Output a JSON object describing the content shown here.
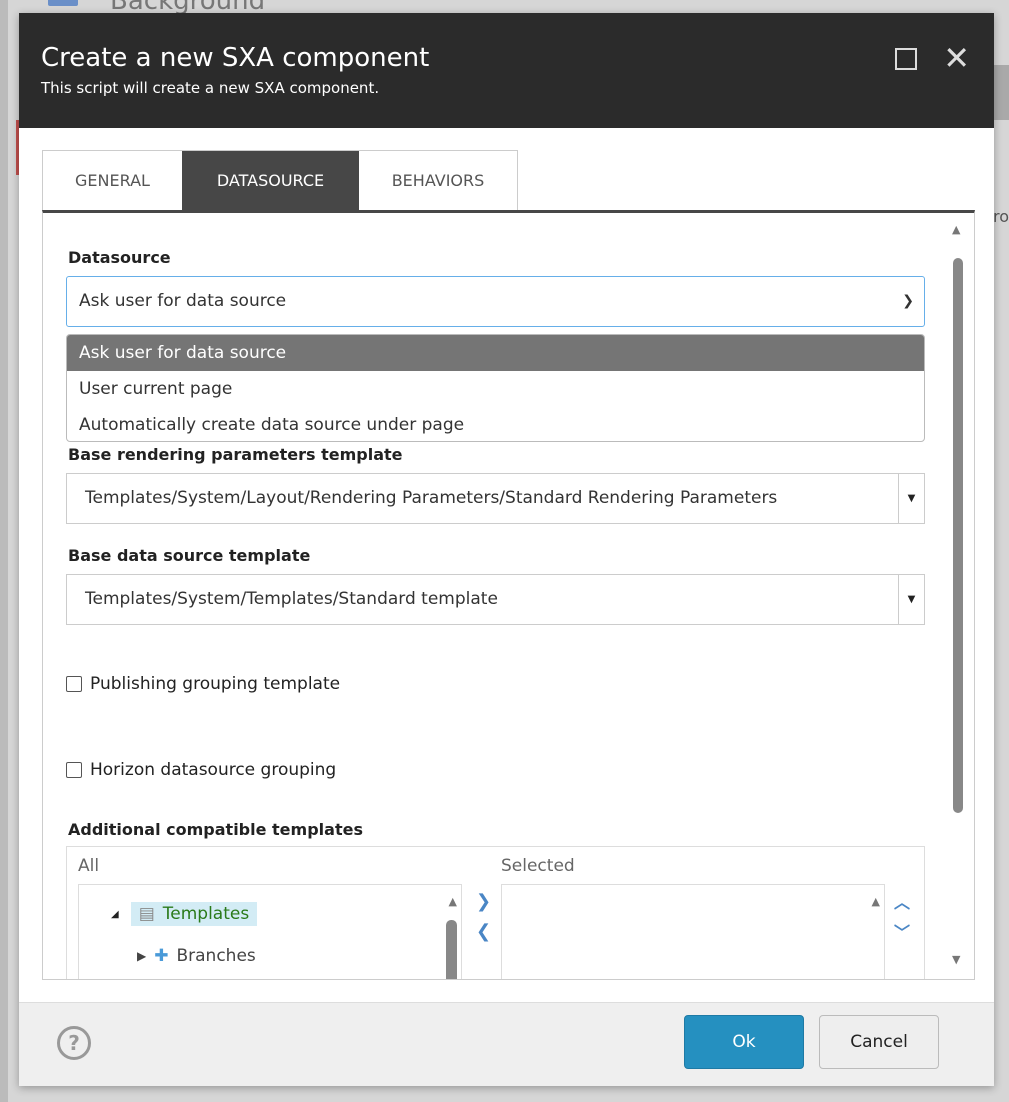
{
  "background": {
    "title": "Background",
    "side_text": "ro"
  },
  "dialog": {
    "title": "Create a new SXA component",
    "subtitle": "This script will create a new SXA component."
  },
  "tabs": [
    {
      "label": "GENERAL"
    },
    {
      "label": "DATASOURCE",
      "active": true
    },
    {
      "label": "BEHAVIORS"
    }
  ],
  "form": {
    "datasource_label": "Datasource",
    "datasource_value": "Ask user for data source",
    "datasource_options": [
      "Ask user for data source",
      "User current page",
      "Automatically create data source under page"
    ],
    "base_rendering_label": "Base rendering parameters template",
    "base_rendering_value": "Templates/System/Layout/Rendering Parameters/Standard Rendering Parameters",
    "base_datasource_label": "Base data source template",
    "base_datasource_value": "Templates/System/Templates/Standard template",
    "publishing_grouping_label": "Publishing grouping template",
    "publishing_grouping_checked": false,
    "horizon_grouping_label": "Horizon datasource grouping",
    "horizon_grouping_checked": false,
    "additional_label": "Additional compatible templates",
    "all_label": "All",
    "selected_label": "Selected",
    "tree": [
      {
        "label": "Templates",
        "expanded": true
      },
      {
        "label": "Branches",
        "expanded": false
      }
    ]
  },
  "footer": {
    "ok": "Ok",
    "cancel": "Cancel"
  },
  "colors": {
    "header": "#2b2b2b",
    "active_tab": "#474747",
    "ok_button": "#2590c0"
  }
}
